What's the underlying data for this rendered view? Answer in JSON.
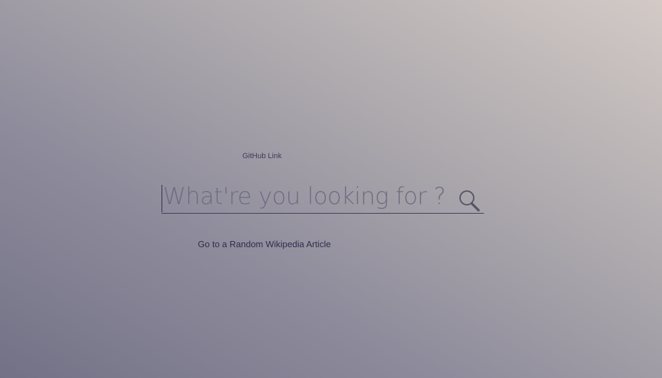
{
  "links": {
    "github": "GitHub Link",
    "random_article": "Go to a Random Wikipedia Article"
  },
  "search": {
    "placeholder": "What're you looking for ?",
    "value": "",
    "button_icon": "search-icon"
  },
  "colors": {
    "text": "#2f2b4d",
    "underline": "#3d3a5e",
    "icon": "#555566"
  }
}
